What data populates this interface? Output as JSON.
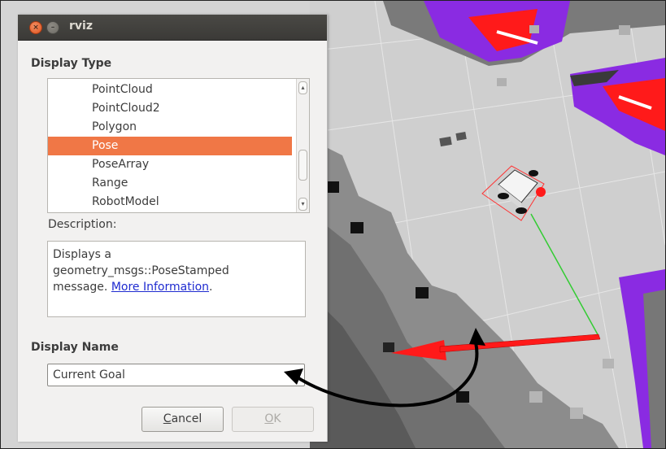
{
  "window": {
    "title": "rviz"
  },
  "display_type": {
    "heading": "Display Type",
    "items": [
      {
        "label": "PointCloud",
        "selected": false
      },
      {
        "label": "PointCloud2",
        "selected": false
      },
      {
        "label": "Polygon",
        "selected": false
      },
      {
        "label": "Pose",
        "selected": true
      },
      {
        "label": "PoseArray",
        "selected": false
      },
      {
        "label": "Range",
        "selected": false
      },
      {
        "label": "RobotModel",
        "selected": false
      }
    ]
  },
  "description": {
    "label": "Description:",
    "line1": "Displays a",
    "line2": "geometry_msgs::PoseStamped",
    "line3_prefix": "message. ",
    "link_text": "More Information",
    "line3_suffix": "."
  },
  "display_name": {
    "heading": "Display Name",
    "value": "Current Goal"
  },
  "buttons": {
    "cancel_label": "Cancel",
    "ok_label": "OK"
  },
  "colors": {
    "selection": "#f07746",
    "obstacle_purple": "#8a2be2",
    "pose_arrow": "#ff1a1a",
    "path_line": "#33cc33"
  },
  "icons": {
    "close": "close-icon",
    "minimize": "minimize-icon"
  }
}
